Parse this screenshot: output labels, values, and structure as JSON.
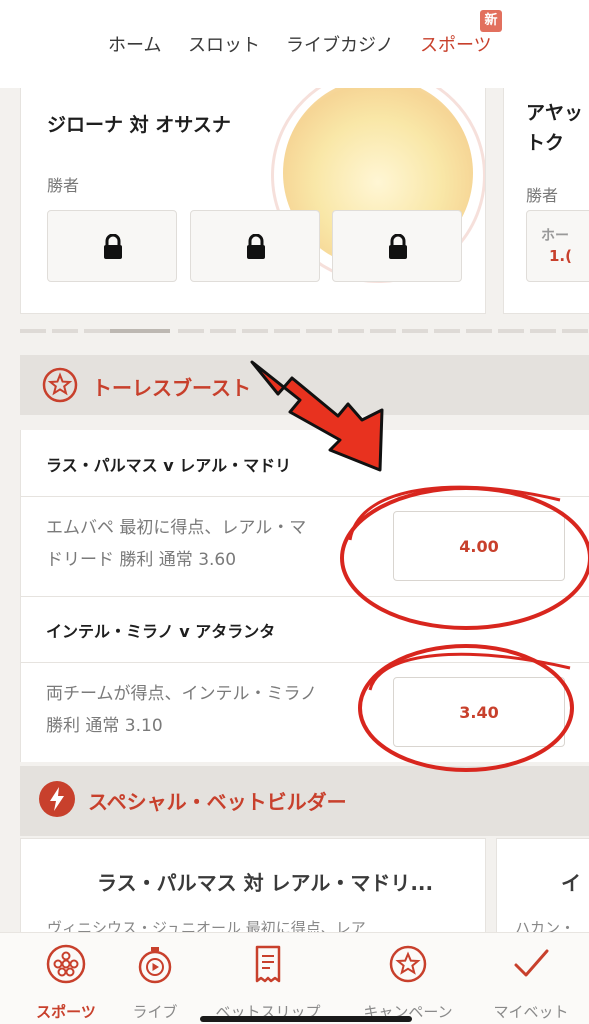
{
  "top_nav": {
    "tabs": [
      {
        "label": "ホーム",
        "active": false
      },
      {
        "label": "スロット",
        "active": false
      },
      {
        "label": "ライブカジノ",
        "active": false
      },
      {
        "label": "スポーツ",
        "active": true
      }
    ],
    "new_badge": "新"
  },
  "featured_matches": [
    {
      "title": "ジローナ 対 オサスナ",
      "market": "勝者",
      "selections": [
        "locked",
        "locked",
        "locked"
      ]
    },
    {
      "title_line1": "アヤッ",
      "title_line2": "トク",
      "market": "勝者",
      "peek_label": "ホー",
      "peek_value": "1.("
    }
  ],
  "torres_boost": {
    "title": "トーレスブースト",
    "icon": "star-icon",
    "items": [
      {
        "match": "ラス・パルマス v レアル・マドリ",
        "desc_line1": "エムバペ 最初に得点、レアル・マ",
        "desc_line2": "ドリード 勝利 通常 3.60",
        "odds": "4.00"
      },
      {
        "match": "インテル・ミラノ v アタランタ",
        "desc_line1": "両チームが得点、インテル・ミラノ",
        "desc_line2": "勝利 通常 3.10",
        "odds": "3.40"
      }
    ]
  },
  "special_betbuilder": {
    "title": "スペシャル・ベットビルダー",
    "icon": "lightning-icon",
    "cards": [
      {
        "title": "ラス・パルマス 対 レアル・マドリ...",
        "desc": "ヴィニシウス・ジュニオール 最初に得点、レア"
      },
      {
        "title": "イ",
        "desc": "ハカン・"
      }
    ]
  },
  "bottom_nav": [
    {
      "label": "スポーツ",
      "icon": "soccer-ball-icon",
      "active": true
    },
    {
      "label": "ライブ",
      "icon": "stopwatch-play-icon",
      "active": false
    },
    {
      "label": "ベットスリップ",
      "icon": "receipt-icon",
      "active": false
    },
    {
      "label": "キャンペーン",
      "icon": "star-badge-icon",
      "active": false
    },
    {
      "label": "マイベット",
      "icon": "checkmark-icon",
      "active": false
    }
  ],
  "colors": {
    "accent": "#c8402c",
    "annotation": "#d8261e"
  }
}
